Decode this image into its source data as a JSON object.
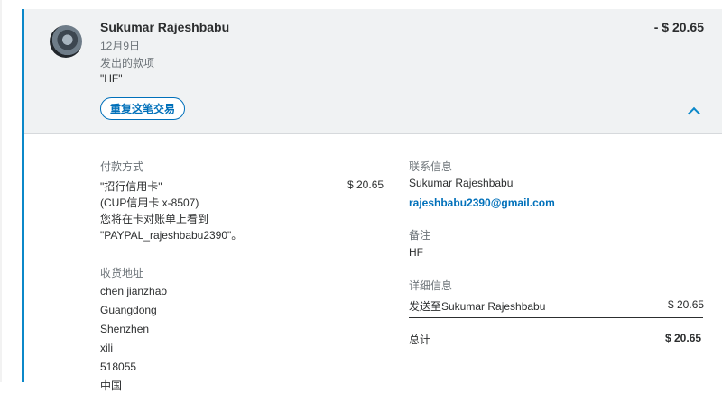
{
  "transaction": {
    "counterparty": "Sukumar Rajeshbabu",
    "amount": "- $ 20.65",
    "date": "12月9日",
    "type": "发出的款项",
    "note_quoted": "\"HF\"",
    "repeat_button": "重复这笔交易"
  },
  "payment": {
    "heading": "付款方式",
    "card_name": "\"招行信用卡\"",
    "card_detail": "(CUP信用卡 x-8507)",
    "statement_hint": "您将在卡对账单上看到",
    "descriptor": "\"PAYPAL_rajeshbabu2390\"。",
    "amount": "$ 20.65"
  },
  "shipping": {
    "heading": "收货地址",
    "lines": [
      "chen jianzhao",
      "Guangdong",
      "Shenzhen",
      "xili",
      "518055",
      "中国"
    ]
  },
  "contact": {
    "heading": "联系信息",
    "name": "Sukumar Rajeshbabu",
    "email": "rajeshbabu2390@gmail.com"
  },
  "remark": {
    "heading": "备注",
    "text": "HF"
  },
  "details": {
    "heading": "详细信息",
    "row_label": "发送至Sukumar Rajeshbabu",
    "row_amount": "$ 20.65",
    "total_label": "总计",
    "total_amount": "$ 20.65"
  },
  "icons": {
    "expand": "chevron-up-icon",
    "avatar": "avatar-photo"
  },
  "colors": {
    "accent": "#0b88c9",
    "link": "#0070ba",
    "header_bg": "#f0f2f3"
  }
}
